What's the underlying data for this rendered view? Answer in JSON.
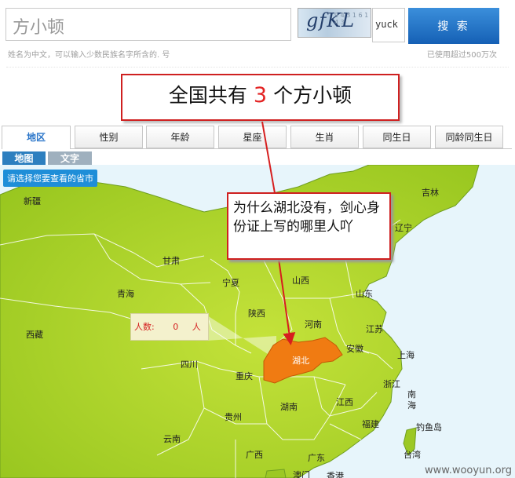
{
  "search": {
    "value": "方小顿",
    "captcha_image_text": "gfKL",
    "captcha_value": "yuck",
    "button_label": "搜 索",
    "hint": "姓名为中文，可以输入少数民族名字所含的. 号",
    "usage": "已使用超过500万次"
  },
  "callout": {
    "prefix": "全国共有",
    "count": "3",
    "suffix": "个方小顿"
  },
  "tabs": [
    {
      "label": "地区",
      "active": true
    },
    {
      "label": "性别"
    },
    {
      "label": "年龄"
    },
    {
      "label": "星座"
    },
    {
      "label": "生肖"
    },
    {
      "label": "同生日"
    },
    {
      "label": "同龄同生日"
    }
  ],
  "subtabs": [
    {
      "label": "地图",
      "active": true
    },
    {
      "label": "文字"
    }
  ],
  "map": {
    "select_hint": "请选择您要查看的省市",
    "highlighted": "湖北",
    "popup": {
      "label": "人数:",
      "value": "0",
      "unit": "人"
    },
    "provinces": [
      "新疆",
      "吉林",
      "辽宁",
      "甘肃",
      "宁夏",
      "山西",
      "青海",
      "山东",
      "陕西",
      "河南",
      "江苏",
      "西藏",
      "安徽",
      "上海",
      "湖北",
      "四川",
      "重庆",
      "浙江",
      "南",
      "海",
      "湖南",
      "江西",
      "钓鱼岛",
      "贵州",
      "福建",
      "云南",
      "台湾",
      "广西",
      "广东",
      "澳门",
      "香港"
    ]
  },
  "annotation": "为什么湖北没有，剑心身份证上写的哪里人吖",
  "watermark": "www.wooyun.org",
  "colors": {
    "accent": "#1560b5",
    "callout_border": "#cf2020",
    "map_land": "#a8d42a",
    "highlight": "#f07b12"
  }
}
